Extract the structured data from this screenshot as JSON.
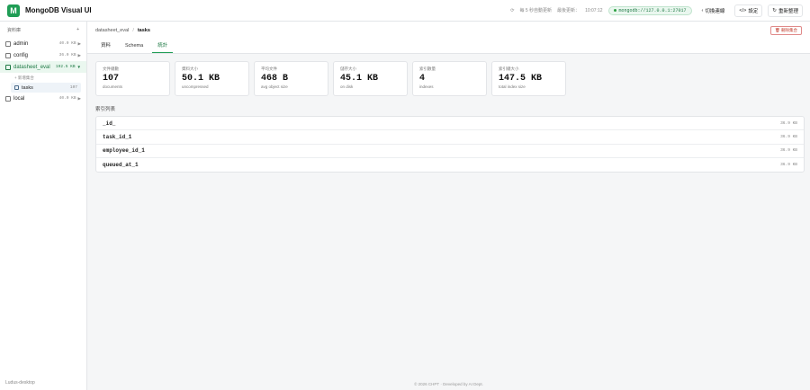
{
  "app": {
    "logo_letter": "M",
    "title": "MongoDB Visual UI"
  },
  "header": {
    "status_text": "每 5 秒自動更新",
    "last_update_label": "最後更新：",
    "last_update_time": "10:07:12",
    "connection": "mongodb://127.0.0.1:27017",
    "switch_conn": "切換連線",
    "settings": "設定",
    "refresh": "重新整理"
  },
  "sidebar": {
    "header": "資料庫",
    "add_icon": "+",
    "databases": [
      {
        "name": "admin",
        "size": "40.0 KB"
      },
      {
        "name": "config",
        "size": "36.0 KB"
      },
      {
        "name": "datasheet_eval",
        "size": "192.5 KB"
      },
      {
        "name": "local",
        "size": "40.0 KB"
      }
    ],
    "new_collection": "+ 新增集合",
    "collection": {
      "name": "tasks",
      "count": "107"
    },
    "footer": "Ludus-desktop"
  },
  "breadcrumb": {
    "db": "datasheet_eval",
    "collection": "tasks"
  },
  "drop_button": "刪除集合",
  "tabs": [
    "資料",
    "Schema",
    "統計"
  ],
  "stats": [
    {
      "label": "文件總數",
      "value": "107",
      "sub": "documents"
    },
    {
      "label": "資料大小",
      "value": "50.1 KB",
      "sub": "uncompressed"
    },
    {
      "label": "平均文件",
      "value": "468 B",
      "sub": "avg object size"
    },
    {
      "label": "儲存大小",
      "value": "45.1 KB",
      "sub": "on disk"
    },
    {
      "label": "索引數量",
      "value": "4",
      "sub": "indexes"
    },
    {
      "label": "索引總大小",
      "value": "147.5 KB",
      "sub": "total index size"
    }
  ],
  "indexes_title": "索引列表",
  "indexes": [
    {
      "name": "_id_",
      "size": "36.9 KB"
    },
    {
      "name": "task_id_1",
      "size": "36.9 KB"
    },
    {
      "name": "employee_id_1",
      "size": "36.9 KB"
    },
    {
      "name": "queued_at_1",
      "size": "36.9 KB"
    }
  ],
  "footer": "© 2026 CHPT · Developed by AI Dept."
}
